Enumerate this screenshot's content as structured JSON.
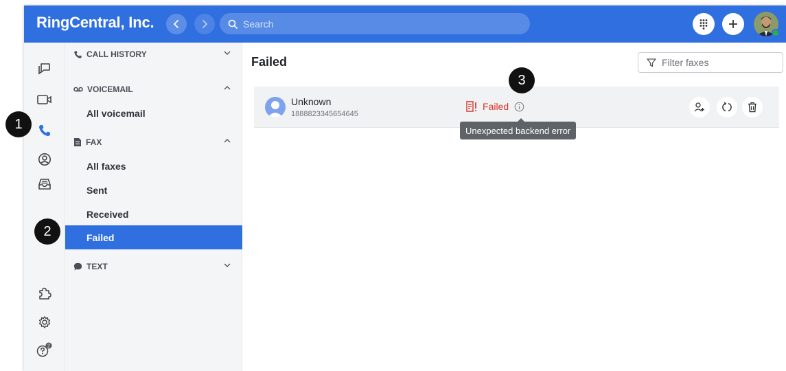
{
  "header": {
    "brand": "RingCentral, Inc.",
    "search_placeholder": "Search"
  },
  "subnav": {
    "call_history": "CALL HISTORY",
    "voicemail": "VOICEMAIL",
    "voicemail_items": [
      "All voicemail"
    ],
    "fax": "FAX",
    "fax_items": [
      "All faxes",
      "Sent",
      "Received",
      "Failed"
    ],
    "text": "TEXT",
    "active_item": "Failed"
  },
  "main": {
    "title": "Failed",
    "filter_placeholder": "Filter faxes",
    "rows": [
      {
        "name": "Unknown",
        "number": "1888823345654645",
        "status": "Failed",
        "tooltip": "Unexpected backend error"
      }
    ]
  },
  "rail": {
    "help_badge": "2"
  },
  "callouts": [
    "1",
    "2",
    "3"
  ],
  "colors": {
    "brand": "#2f6fe0",
    "error": "#d9362b",
    "presence": "#28b04a"
  }
}
